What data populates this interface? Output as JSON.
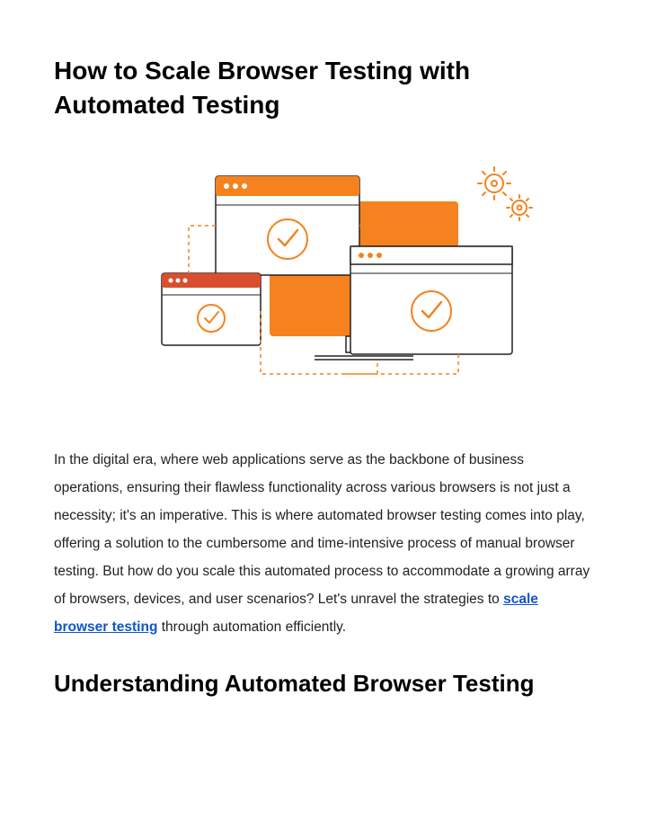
{
  "title": "How to Scale Browser Testing with Automated Testing",
  "paragraph": {
    "pre_link": "In the digital era, where web applications serve as the backbone of business operations, ensuring their flawless functionality across various browsers is not just a necessity; it's an imperative. This is where automated browser testing comes into play, offering a solution to the cumbersome and time-intensive process of manual browser testing. But how do you scale this automated process to accommodate a growing array of browsers, devices, and user scenarios? Let's unravel the strategies to ",
    "link_text": "scale browser testing",
    "post_link": " through automation efficiently."
  },
  "section_heading": "Understanding Automated Browser Testing",
  "colors": {
    "accent": "#f5821f",
    "link": "#1155cc"
  }
}
